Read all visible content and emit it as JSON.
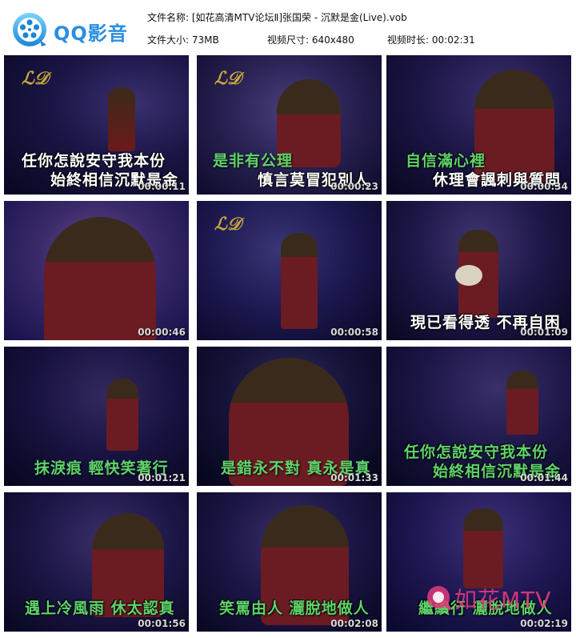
{
  "app": {
    "name": "QQ影音"
  },
  "info": {
    "file_name_label": "文件名称:",
    "file_name": "[如花高清MTV论坛Ⅱ]张国荣 - 沉默是金(Live).vob",
    "file_size_label": "文件大小:",
    "file_size": "73MB",
    "video_size_label": "视频尺寸:",
    "video_size": "640x480",
    "duration_label": "视频时长:",
    "duration": "00:02:31"
  },
  "thumbnails": [
    {
      "lines": [
        "任你怎說安守我本份",
        "始終相信沉默是金"
      ],
      "color": "white",
      "time": "00:00:11"
    },
    {
      "lines": [
        "是非有公理",
        "慎言莫冒犯別人"
      ],
      "color": "mixed",
      "time": "00:00:23"
    },
    {
      "lines": [
        "自信滿心裡",
        "休理會諷刺與質問"
      ],
      "color": "mixed",
      "time": "00:00:34"
    },
    {
      "lines": [],
      "color": "white",
      "time": "00:00:46"
    },
    {
      "lines": [],
      "color": "white",
      "time": "00:00:58"
    },
    {
      "lines": [
        "現已看得透 不再自困"
      ],
      "color": "white",
      "time": "00:01:09"
    },
    {
      "lines": [
        "抹淚痕 輕快笑著行"
      ],
      "color": "mixed",
      "time": "00:01:21"
    },
    {
      "lines": [
        "是錯永不對 真永是真"
      ],
      "color": "mixed",
      "time": "00:01:33"
    },
    {
      "lines": [
        "任你怎說安守我本份",
        "始終相信沉默是金"
      ],
      "color": "mixed",
      "time": "00:01:44"
    },
    {
      "lines": [
        "遇上冷風雨 休太認真"
      ],
      "color": "mixed",
      "time": "00:01:56"
    },
    {
      "lines": [
        "笑罵由人 灑脫地做人"
      ],
      "color": "mixed",
      "time": "00:02:08"
    },
    {
      "lines": [
        "繼續行 灑脫地做人"
      ],
      "color": "mixed",
      "time": "00:02:19"
    }
  ],
  "watermark": {
    "text": "如花MTV"
  },
  "colors": {
    "accent": "#2a8ee0",
    "green_sub": "#5fd36a",
    "watermark": "#e23b79"
  }
}
